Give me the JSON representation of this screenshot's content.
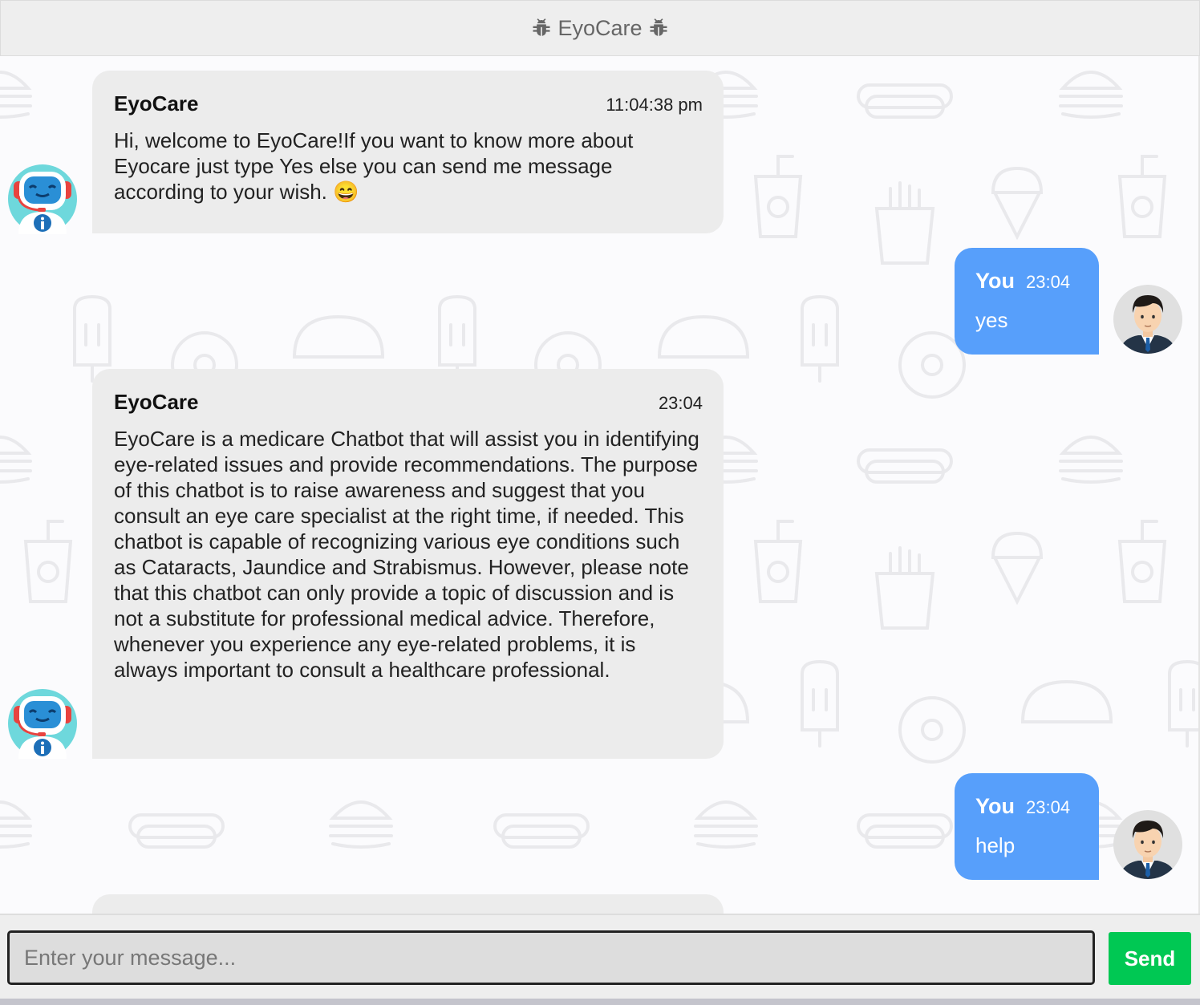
{
  "header": {
    "title": "EyoCare",
    "left_icon": "bug-icon",
    "right_icon": "bug-icon"
  },
  "messages": [
    {
      "sender": "EyoCare",
      "time": "11:04:38 pm",
      "text": "Hi, welcome to EyoCare!If you want to know more about Eyocare just type Yes else you can send me message according to your wish. 😄"
    },
    {
      "sender": "You",
      "time": "23:04",
      "text": "yes"
    },
    {
      "sender": "EyoCare",
      "time": "23:04",
      "text": "EyoCare is a medicare Chatbot that will assist you in identifying eye-related issues and provide recommendations. The purpose of this chatbot is to raise awareness and suggest that you consult an eye care specialist at the right time, if needed. This chatbot is capable of recognizing various eye conditions such as Cataracts, Jaundice and Strabismus. However, please note that this chatbot can only provide a topic of discussion and is not a substitute for professional medical advice. Therefore, whenever you experience any eye-related problems, it is always important to consult a healthcare professional."
    },
    {
      "sender": "You",
      "time": "23:04",
      "text": "help"
    }
  ],
  "composer": {
    "placeholder": "Enter your message...",
    "value": "",
    "send_label": "Send"
  },
  "colors": {
    "user_bubble": "#579ffb",
    "bot_bubble": "#ececec",
    "send_button": "#00c853"
  }
}
